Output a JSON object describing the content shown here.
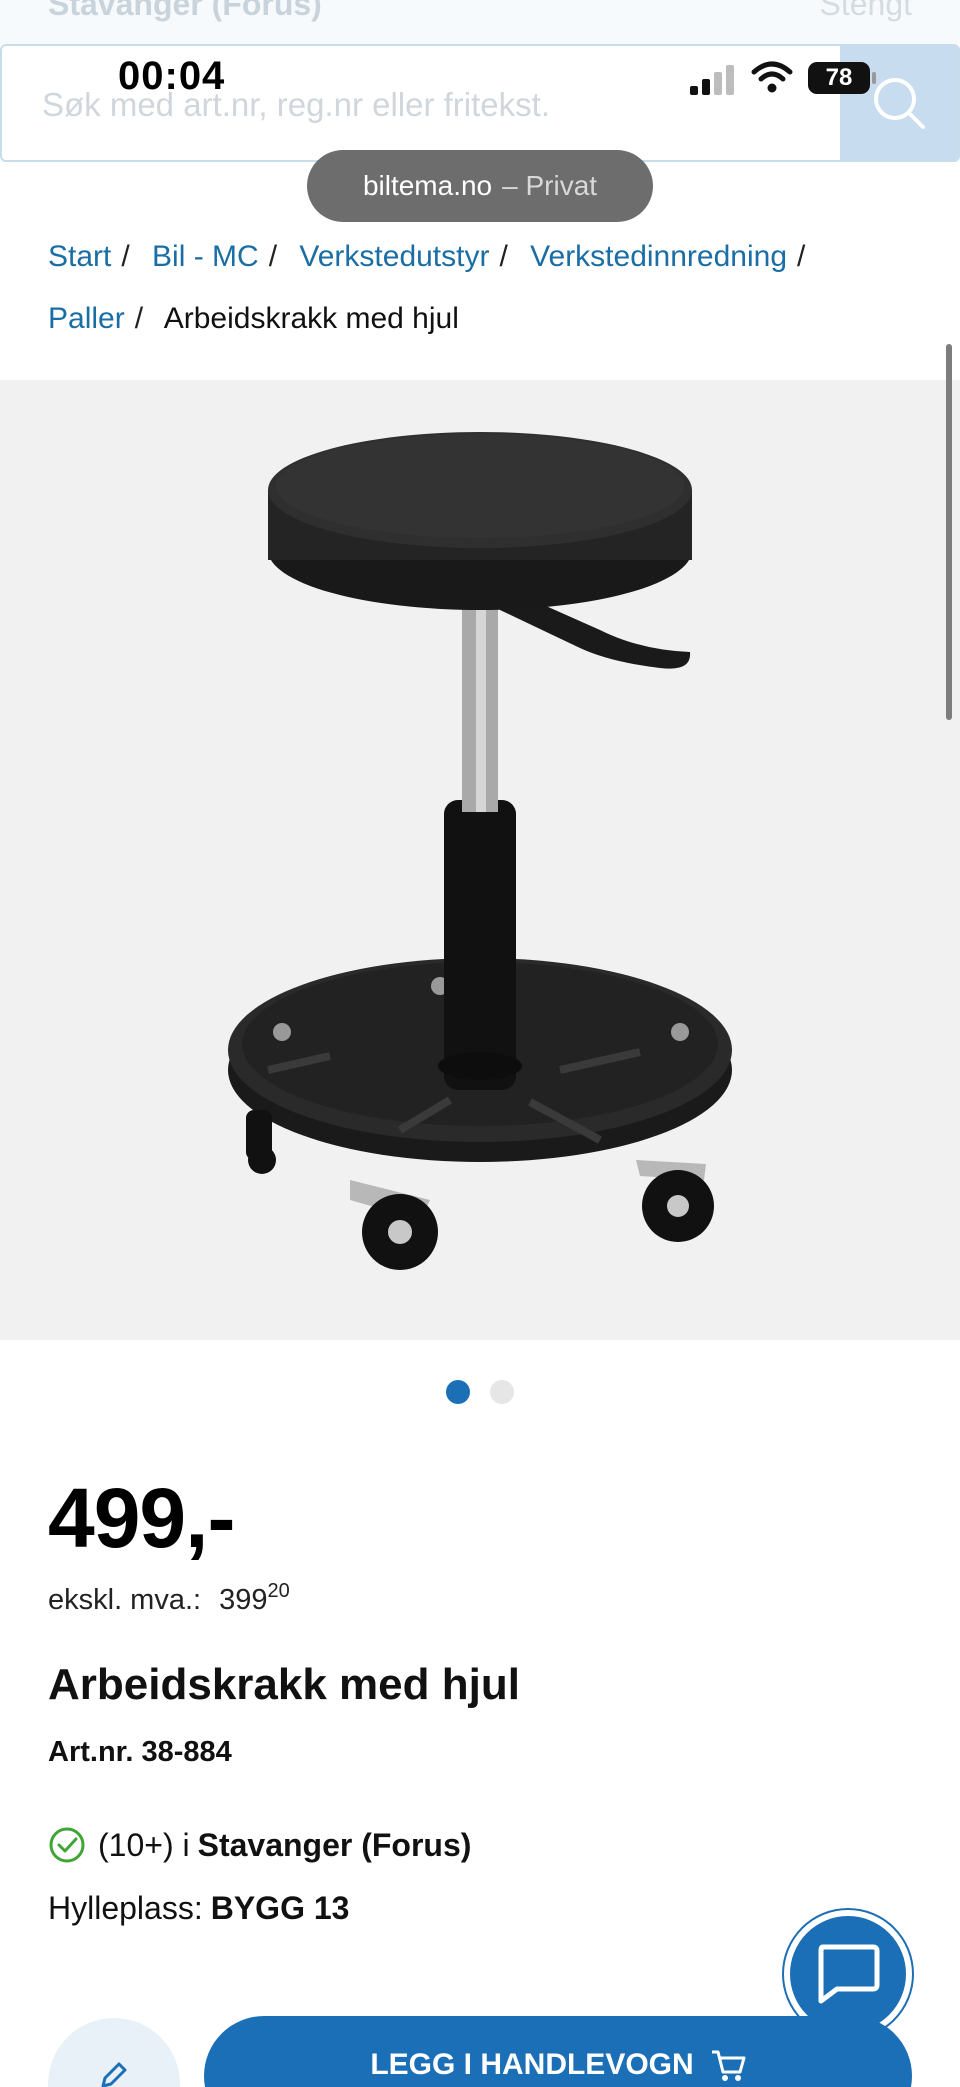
{
  "store_bar": {
    "store_name": "Stavanger (Forus)",
    "status": "Stengt"
  },
  "search": {
    "placeholder": "Søk med art.nr, reg.nr eller fritekst."
  },
  "ios": {
    "time": "00:04",
    "battery": "78"
  },
  "url_pill": {
    "domain": "biltema.no",
    "mode": "– Privat"
  },
  "breadcrumb": [
    {
      "label": "Start"
    },
    {
      "label": "Bil - MC"
    },
    {
      "label": "Verkstedutstyr"
    },
    {
      "label": "Verkstedinnredning"
    },
    {
      "label": "Paller"
    },
    {
      "label": "Arbeidskrakk med hjul"
    }
  ],
  "gallery": {
    "current_slide": 1,
    "total_slides": 2
  },
  "product": {
    "price": "499,-",
    "ex_vat_label": "ekskl. mva.:",
    "ex_vat_int": "399",
    "ex_vat_dec": "20",
    "title": "Arbeidskrakk med hjul",
    "art_nr": "Art.nr. 38-884",
    "stock_count": "(10+) i",
    "stock_store": "Stavanger (Forus)",
    "shelf_label": "Hylleplass:",
    "shelf_value": "BYGG 13"
  },
  "actions": {
    "add_to_cart": "LEGG I HANDLEVOGN"
  },
  "colors": {
    "brand_blue": "#1b6fb6",
    "link_blue": "#1a6ea5",
    "check_green": "#3fa535"
  },
  "icons": [
    "search-icon",
    "signal-icon",
    "wifi-icon",
    "battery-icon",
    "check-icon",
    "chat-icon",
    "edit-icon",
    "cart-icon"
  ]
}
